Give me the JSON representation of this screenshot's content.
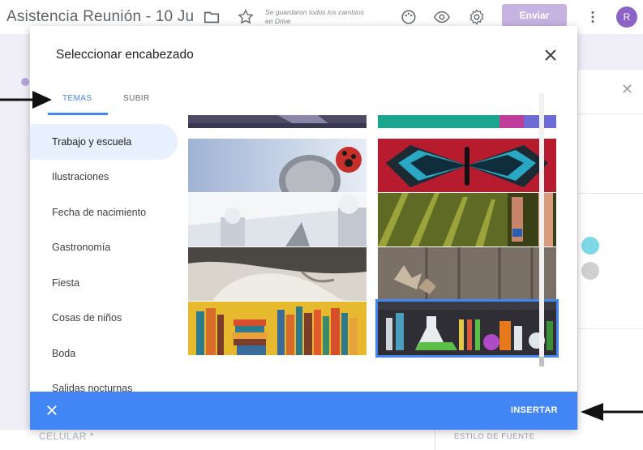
{
  "app": {
    "doc_title": "Asistencia Reunión - 10 Ju",
    "save_status": "Se guardaron todos los cambios en Drive",
    "send_label": "Enviar",
    "avatar_initial": "R"
  },
  "dialog": {
    "title": "Seleccionar encabezado",
    "tabs": [
      {
        "label": "TEMAS",
        "active": true
      },
      {
        "label": "SUBIR",
        "active": false
      }
    ],
    "categories": [
      {
        "label": "Trabajo y escuela",
        "active": true
      },
      {
        "label": "Ilustraciones",
        "active": false
      },
      {
        "label": "Fecha de nacimiento",
        "active": false
      },
      {
        "label": "Gastronomía",
        "active": false
      },
      {
        "label": "Fiesta",
        "active": false
      },
      {
        "label": "Cosas de niños",
        "active": false
      },
      {
        "label": "Boda",
        "active": false
      },
      {
        "label": "Salidas nocturnas",
        "active": false
      }
    ],
    "insert_label": "INSERTAR",
    "accent_color": "#4285f4"
  },
  "background": {
    "field_label": "CELULAR *",
    "style_label": "ESTILO DE FUENTE",
    "theme_colors": [
      "#7fd8e6",
      "#cfcfcf"
    ]
  },
  "icons": [
    "folder-icon",
    "star-icon",
    "palette-icon",
    "preview-eye-icon",
    "settings-gear-icon",
    "more-vert-icon",
    "close-icon"
  ]
}
